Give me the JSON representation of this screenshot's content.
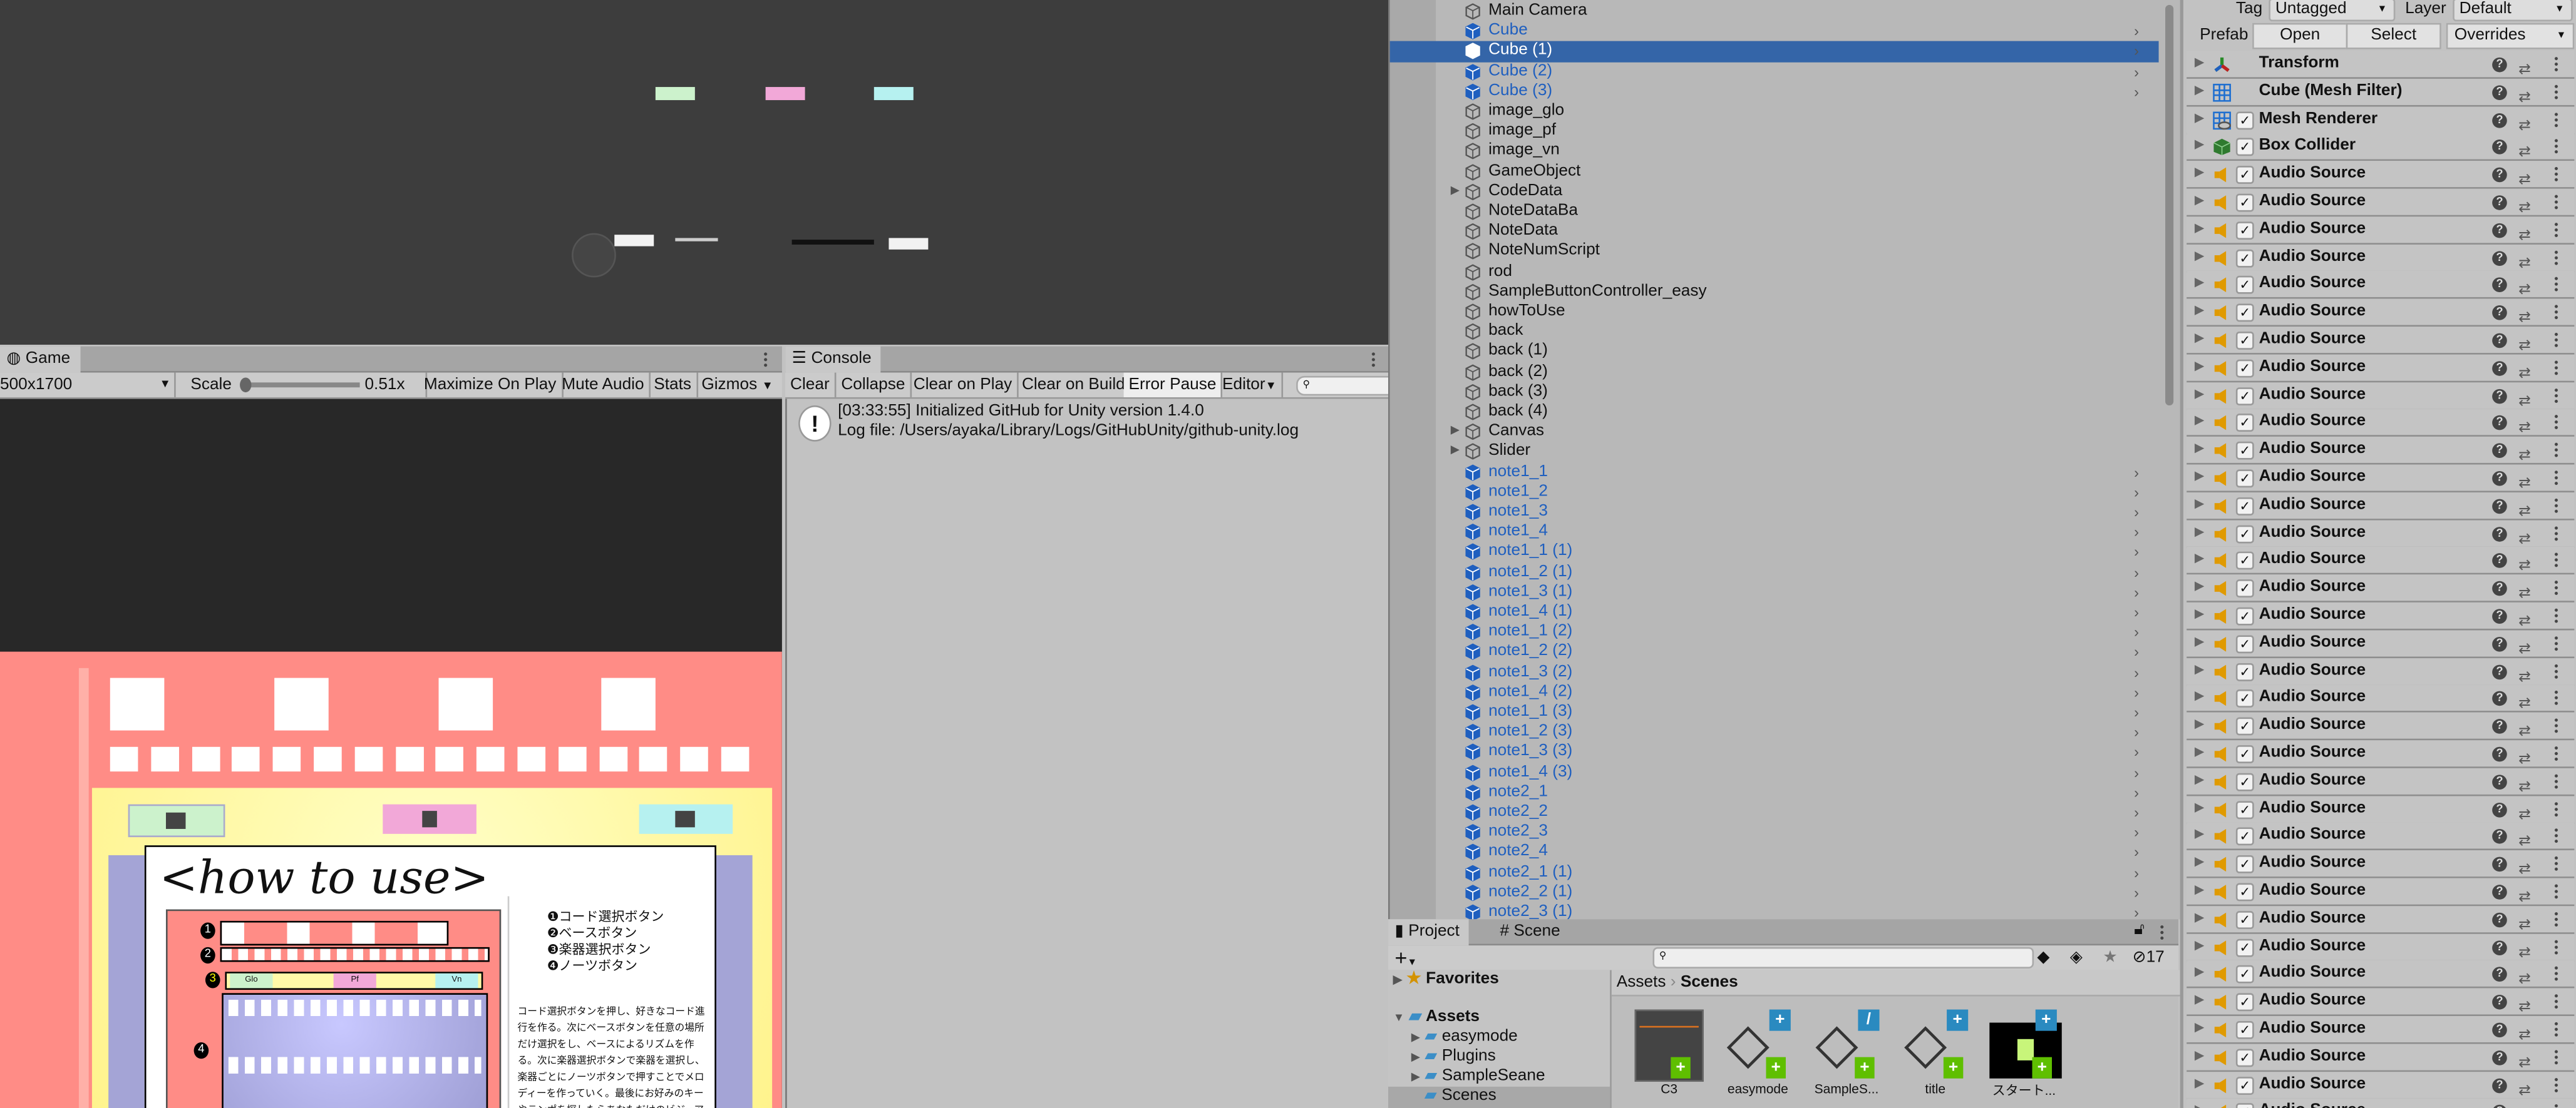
{
  "game": {
    "tab_label": "Game",
    "resolution": "500x1700",
    "scale_label": "Scale",
    "scale_value": "0.51x",
    "scale_fraction": 0.0,
    "buttons": [
      "Maximize On Play",
      "Mute Audio",
      "Stats",
      "Gizmos"
    ],
    "content": {
      "title": "<how to use>",
      "legend": [
        "❶コード選択ボタン",
        "❷ベースボタン",
        "❸楽器選択ボタン",
        "❹ノーツボタン"
      ],
      "instrument_labels": [
        "Glo",
        "Pf",
        "Vn"
      ],
      "markers": [
        "1",
        "2",
        "3",
        "4"
      ],
      "paragraph": "コード選択ボタンを押し、好きなコード進行を作る。次にベースボタンを任意の場所だけ選択をし、ベースによるリズムを作る。次に楽器選択ボタンで楽器を選択し、楽器ごとにノーツボタンで押すことでメロディーを作っていく。最後にお好みのキーやテンポを探したらあなただけのビジュアルミュー",
      "colors": {
        "background": "#ff8c86",
        "panel": "#fffaa8",
        "green": "#ccf2cc",
        "pink": "#f2a8d8",
        "cyan": "#b6f1f0",
        "purple": "#a4a4d6"
      }
    }
  },
  "console": {
    "tab_label": "Console",
    "buttons": [
      "Clear",
      "Collapse",
      "Clear on Play",
      "Clear on Build",
      "Error Pause",
      "Editor"
    ],
    "messages": [
      {
        "line1": "[03:33:55] Initialized GitHub for Unity version 1.4.0",
        "line2": "Log file: /Users/ayaka/Library/Logs/GitHubUnity/github-unity.log"
      }
    ]
  },
  "hierarchy": {
    "selected_index": 2,
    "items": [
      {
        "label": "Main Camera",
        "prefab": false,
        "expandable": false
      },
      {
        "label": "Cube",
        "prefab": true,
        "expandable": false
      },
      {
        "label": "Cube (1)",
        "prefab": true,
        "expandable": false
      },
      {
        "label": "Cube (2)",
        "prefab": true,
        "expandable": false
      },
      {
        "label": "Cube (3)",
        "prefab": true,
        "expandable": false
      },
      {
        "label": "image_glo",
        "prefab": false,
        "expandable": false
      },
      {
        "label": "image_pf",
        "prefab": false,
        "expandable": false
      },
      {
        "label": "image_vn",
        "prefab": false,
        "expandable": false
      },
      {
        "label": "GameObject",
        "prefab": false,
        "expandable": false
      },
      {
        "label": "CodeData",
        "prefab": false,
        "expandable": true
      },
      {
        "label": "NoteDataBa",
        "prefab": false,
        "expandable": false
      },
      {
        "label": "NoteData",
        "prefab": false,
        "expandable": false
      },
      {
        "label": "NoteNumScript",
        "prefab": false,
        "expandable": false
      },
      {
        "label": "rod",
        "prefab": false,
        "expandable": false
      },
      {
        "label": "SampleButtonController_easy",
        "prefab": false,
        "expandable": false
      },
      {
        "label": "howToUse",
        "prefab": false,
        "expandable": false
      },
      {
        "label": "back",
        "prefab": false,
        "expandable": false
      },
      {
        "label": "back (1)",
        "prefab": false,
        "expandable": false
      },
      {
        "label": "back (2)",
        "prefab": false,
        "expandable": false
      },
      {
        "label": "back (3)",
        "prefab": false,
        "expandable": false
      },
      {
        "label": "back (4)",
        "prefab": false,
        "expandable": false
      },
      {
        "label": "Canvas",
        "prefab": false,
        "expandable": true
      },
      {
        "label": "Slider",
        "prefab": false,
        "expandable": true
      },
      {
        "label": "note1_1",
        "prefab": true,
        "expandable": false
      },
      {
        "label": "note1_2",
        "prefab": true,
        "expandable": false
      },
      {
        "label": "note1_3",
        "prefab": true,
        "expandable": false
      },
      {
        "label": "note1_4",
        "prefab": true,
        "expandable": false
      },
      {
        "label": "note1_1 (1)",
        "prefab": true,
        "expandable": false
      },
      {
        "label": "note1_2 (1)",
        "prefab": true,
        "expandable": false
      },
      {
        "label": "note1_3 (1)",
        "prefab": true,
        "expandable": false
      },
      {
        "label": "note1_4 (1)",
        "prefab": true,
        "expandable": false
      },
      {
        "label": "note1_1 (2)",
        "prefab": true,
        "expandable": false
      },
      {
        "label": "note1_2 (2)",
        "prefab": true,
        "expandable": false
      },
      {
        "label": "note1_3 (2)",
        "prefab": true,
        "expandable": false
      },
      {
        "label": "note1_4 (2)",
        "prefab": true,
        "expandable": false
      },
      {
        "label": "note1_1 (3)",
        "prefab": true,
        "expandable": false
      },
      {
        "label": "note1_2 (3)",
        "prefab": true,
        "expandable": false
      },
      {
        "label": "note1_3 (3)",
        "prefab": true,
        "expandable": false
      },
      {
        "label": "note1_4 (3)",
        "prefab": true,
        "expandable": false
      },
      {
        "label": "note2_1",
        "prefab": true,
        "expandable": false
      },
      {
        "label": "note2_2",
        "prefab": true,
        "expandable": false
      },
      {
        "label": "note2_3",
        "prefab": true,
        "expandable": false
      },
      {
        "label": "note2_4",
        "prefab": true,
        "expandable": false
      },
      {
        "label": "note2_1 (1)",
        "prefab": true,
        "expandable": false
      },
      {
        "label": "note2_2 (1)",
        "prefab": true,
        "expandable": false
      },
      {
        "label": "note2_3 (1)",
        "prefab": true,
        "expandable": false
      }
    ]
  },
  "project": {
    "tabs": [
      "Project",
      "Scene"
    ],
    "filter_count": "17",
    "tree": [
      {
        "label": "Favorites",
        "icon": "star-icon"
      },
      {
        "label": "Assets",
        "icon": "folder-icon"
      },
      {
        "label": "easymode",
        "icon": "folder-icon"
      },
      {
        "label": "Plugins",
        "icon": "folder-icon"
      },
      {
        "label": "SampleSeane",
        "icon": "folder-icon"
      },
      {
        "label": "Scenes",
        "icon": "folder-icon"
      }
    ],
    "breadcrumb": [
      "Assets",
      "Scenes"
    ],
    "assets": [
      "C3",
      "easymode",
      "SampleS...",
      "title",
      "スタート..."
    ]
  },
  "inspector": {
    "tag_label": "Tag",
    "tag_value": "Untagged",
    "layer_label": "Layer",
    "layer_value": "Default",
    "prefab_label": "Prefab",
    "open_label": "Open",
    "select_label": "Select",
    "overrides_label": "Overrides",
    "components": [
      {
        "name": "Transform",
        "icon": "transform-icon",
        "toggle": false
      },
      {
        "name": "Cube (Mesh Filter)",
        "icon": "mesh-filter-icon",
        "toggle": false
      },
      {
        "name": "Mesh Renderer",
        "icon": "mesh-renderer-icon",
        "toggle": true
      },
      {
        "name": "Box Collider",
        "icon": "box-collider-icon",
        "toggle": true
      },
      {
        "name": "Audio Source",
        "icon": "audio-source-icon",
        "toggle": true
      },
      {
        "name": "Audio Source",
        "icon": "audio-source-icon",
        "toggle": true
      },
      {
        "name": "Audio Source",
        "icon": "audio-source-icon",
        "toggle": true
      },
      {
        "name": "Audio Source",
        "icon": "audio-source-icon",
        "toggle": true
      },
      {
        "name": "Audio Source",
        "icon": "audio-source-icon",
        "toggle": true
      },
      {
        "name": "Audio Source",
        "icon": "audio-source-icon",
        "toggle": true
      },
      {
        "name": "Audio Source",
        "icon": "audio-source-icon",
        "toggle": true
      },
      {
        "name": "Audio Source",
        "icon": "audio-source-icon",
        "toggle": true
      },
      {
        "name": "Audio Source",
        "icon": "audio-source-icon",
        "toggle": true
      },
      {
        "name": "Audio Source",
        "icon": "audio-source-icon",
        "toggle": true
      },
      {
        "name": "Audio Source",
        "icon": "audio-source-icon",
        "toggle": true
      },
      {
        "name": "Audio Source",
        "icon": "audio-source-icon",
        "toggle": true
      },
      {
        "name": "Audio Source",
        "icon": "audio-source-icon",
        "toggle": true
      },
      {
        "name": "Audio Source",
        "icon": "audio-source-icon",
        "toggle": true
      },
      {
        "name": "Audio Source",
        "icon": "audio-source-icon",
        "toggle": true
      },
      {
        "name": "Audio Source",
        "icon": "audio-source-icon",
        "toggle": true
      },
      {
        "name": "Audio Source",
        "icon": "audio-source-icon",
        "toggle": true
      },
      {
        "name": "Audio Source",
        "icon": "audio-source-icon",
        "toggle": true
      },
      {
        "name": "Audio Source",
        "icon": "audio-source-icon",
        "toggle": true
      },
      {
        "name": "Audio Source",
        "icon": "audio-source-icon",
        "toggle": true
      },
      {
        "name": "Audio Source",
        "icon": "audio-source-icon",
        "toggle": true
      },
      {
        "name": "Audio Source",
        "icon": "audio-source-icon",
        "toggle": true
      },
      {
        "name": "Audio Source",
        "icon": "audio-source-icon",
        "toggle": true
      },
      {
        "name": "Audio Source",
        "icon": "audio-source-icon",
        "toggle": true
      },
      {
        "name": "Audio Source",
        "icon": "audio-source-icon",
        "toggle": true
      },
      {
        "name": "Audio Source",
        "icon": "audio-source-icon",
        "toggle": true
      },
      {
        "name": "Audio Source",
        "icon": "audio-source-icon",
        "toggle": true
      },
      {
        "name": "Audio Source",
        "icon": "audio-source-icon",
        "toggle": true
      },
      {
        "name": "Audio Source",
        "icon": "audio-source-icon",
        "toggle": true
      },
      {
        "name": "Audio Source",
        "icon": "audio-source-icon",
        "toggle": true
      },
      {
        "name": "Audio Source",
        "icon": "audio-source-icon",
        "toggle": true
      },
      {
        "name": "Audio Source",
        "icon": "audio-source-icon",
        "toggle": true
      },
      {
        "name": "Audio Source",
        "icon": "audio-source-icon",
        "toggle": true
      },
      {
        "name": "Audio Source",
        "icon": "audio-source-icon",
        "toggle": true
      },
      {
        "name": "Audio Source",
        "icon": "audio-source-icon",
        "toggle": true
      }
    ]
  }
}
